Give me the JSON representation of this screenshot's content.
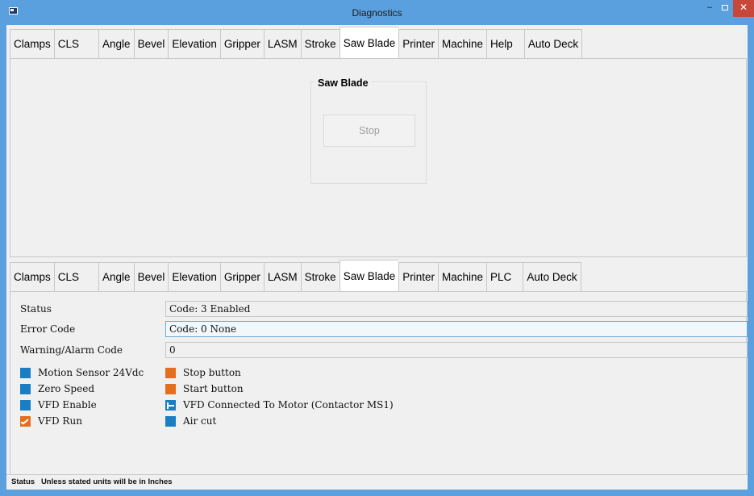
{
  "window": {
    "title": "Diagnostics",
    "minimize_label": "–",
    "close_label": "✕"
  },
  "top_tabs": [
    {
      "label": "Clamps"
    },
    {
      "label": "CLS"
    },
    {
      "label": "Angle"
    },
    {
      "label": "Bevel"
    },
    {
      "label": "Elevation"
    },
    {
      "label": "Gripper"
    },
    {
      "label": "LASM"
    },
    {
      "label": "Stroke"
    },
    {
      "label": "Saw Blade"
    },
    {
      "label": "Printer"
    },
    {
      "label": "Machine"
    },
    {
      "label": "Help"
    },
    {
      "label": "Auto Deck"
    }
  ],
  "top_panel": {
    "group_title": "Saw Blade",
    "stop_label": "Stop"
  },
  "bottom_tabs": [
    {
      "label": "Clamps"
    },
    {
      "label": "CLS"
    },
    {
      "label": "Angle"
    },
    {
      "label": "Bevel"
    },
    {
      "label": "Elevation"
    },
    {
      "label": "Gripper"
    },
    {
      "label": "LASM"
    },
    {
      "label": "Stroke"
    },
    {
      "label": "Saw Blade"
    },
    {
      "label": "Printer"
    },
    {
      "label": "Machine"
    },
    {
      "label": "PLC"
    },
    {
      "label": "Auto Deck"
    }
  ],
  "active_tab": "Saw Blade",
  "fields": {
    "status": {
      "label": "Status",
      "value": "Code: 3 Enabled"
    },
    "error": {
      "label": "Error Code",
      "value": "Code: 0 None"
    },
    "warning": {
      "label": "Warning/Alarm Code",
      "value": "0"
    }
  },
  "indicators": {
    "motion_sensor": {
      "label": "Motion Sensor 24Vdc",
      "color": "#1b7ec2"
    },
    "zero_speed": {
      "label": "Zero Speed",
      "color": "#1b7ec2"
    },
    "vfd_enable": {
      "label": "VFD Enable",
      "color": "#1b7ec2"
    },
    "vfd_run": {
      "label": "VFD Run",
      "color": "#e36f1e"
    },
    "stop_button": {
      "label": "Stop button",
      "color": "#e36f1e"
    },
    "start_button": {
      "label": "Start button",
      "color": "#e36f1e"
    },
    "vfd_connected": {
      "label": "VFD Connected To Motor (Contactor MS1)",
      "color": "#1b7ec2"
    },
    "air_cut": {
      "label": "Air cut",
      "color": "#1b7ec2"
    }
  },
  "statusbar": {
    "text": "Status   Unless stated units will be in Inches"
  }
}
